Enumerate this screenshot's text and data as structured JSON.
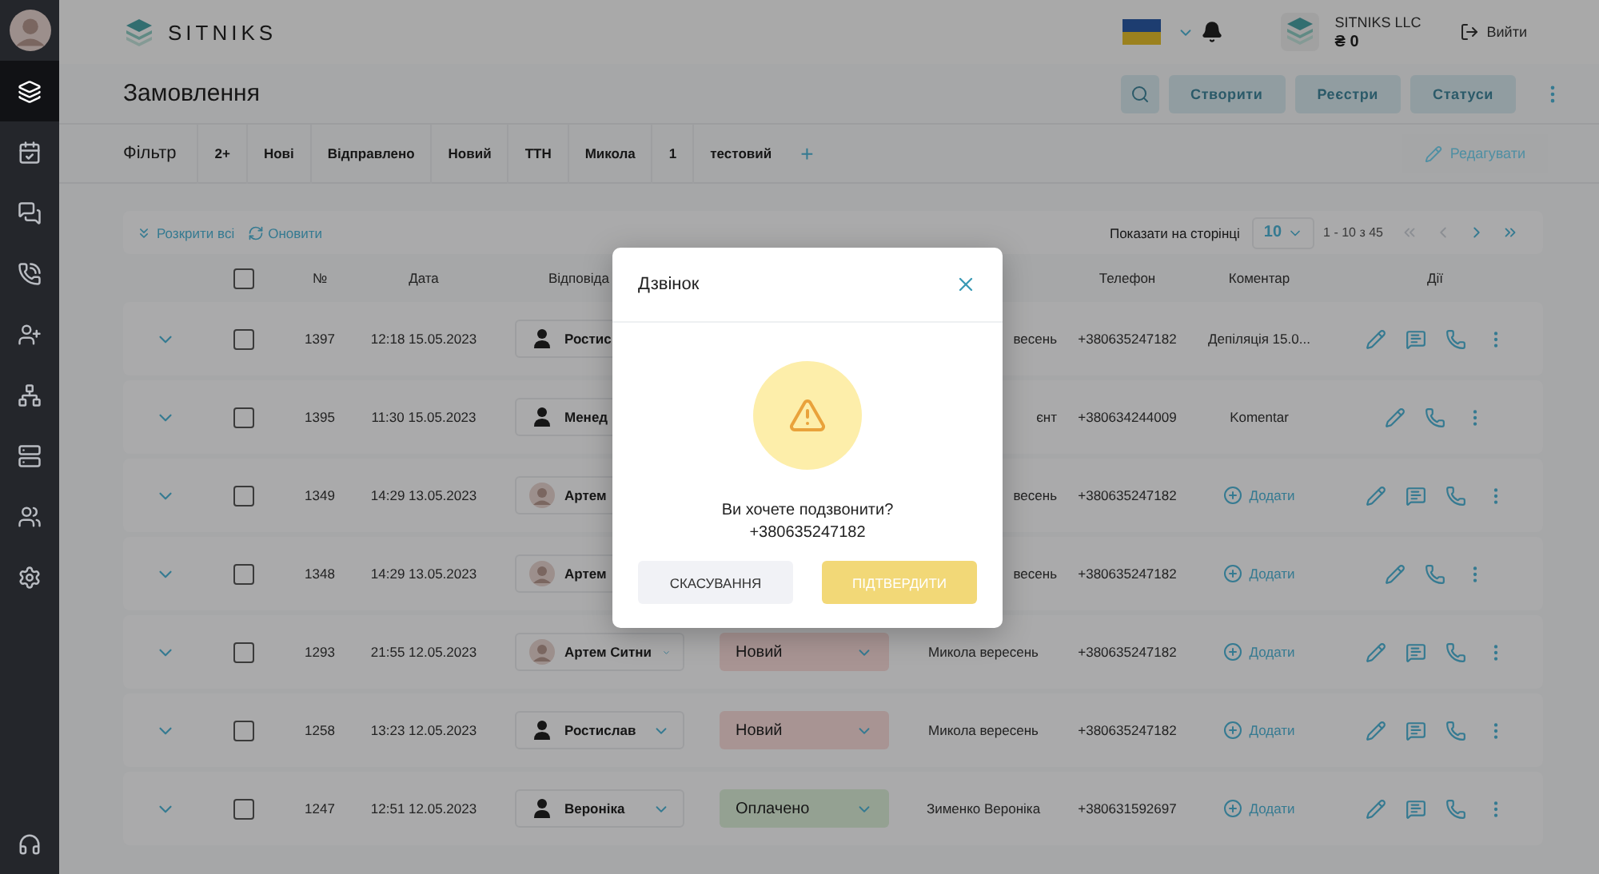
{
  "sidebar": {
    "items": [
      {
        "kind": "orders",
        "selected": true
      },
      {
        "kind": "calendar",
        "selected": false
      },
      {
        "kind": "chats",
        "selected": false
      },
      {
        "kind": "calls",
        "selected": false
      },
      {
        "kind": "add-user",
        "selected": false
      },
      {
        "kind": "structure",
        "selected": false
      },
      {
        "kind": "storage",
        "selected": false
      },
      {
        "kind": "users",
        "selected": false
      },
      {
        "kind": "settings",
        "selected": false
      }
    ],
    "bottom_item": {
      "kind": "support",
      "selected": false
    }
  },
  "header": {
    "logo": "SITNIKS",
    "company": "SITNIKS LLC",
    "balance": "₴ 0",
    "logout": "Вийти"
  },
  "page": {
    "title": "Замовлення",
    "buttons": [
      "Створити",
      "Реєстри",
      "Статуси"
    ]
  },
  "filter": {
    "label": "Фільтр",
    "chips": [
      "2+",
      "Нові",
      "Відправлено",
      "Новий",
      "ТТН",
      "Микола",
      "1",
      "тестовий"
    ],
    "add": "+",
    "edit": "Редагувати"
  },
  "toolbar": {
    "expand_all": "Розкрити всі",
    "refresh": "Оновити",
    "page_size_label": "Показати на сторінці",
    "page_size": "10",
    "range": "1 - 10 з 45"
  },
  "table": {
    "all_checked": false,
    "columns": [
      "№",
      "Дата",
      "Відповіда",
      "Телефон",
      "Коментар",
      "Дії"
    ],
    "rows": [
      {
        "number": "1397",
        "date": "12:18 15.05.2023",
        "responsible": {
          "name": "Ростис",
          "kind": "user"
        },
        "client": "весень",
        "phone": "+380635247182",
        "comment": {
          "kind": "text",
          "text": "Депіляція 15.0..."
        },
        "actions": [
          {
            "kind": "edit"
          },
          {
            "kind": "comment"
          },
          {
            "kind": "call"
          },
          {
            "kind": "more"
          }
        ],
        "checked": false
      },
      {
        "number": "1395",
        "date": "11:30 15.05.2023",
        "responsible": {
          "name": "Менед",
          "kind": "user"
        },
        "client": "єнт",
        "phone": "+380634244009",
        "comment": {
          "kind": "text",
          "text": "Komentar"
        },
        "actions": [
          {
            "kind": "edit"
          },
          {
            "kind": "call"
          },
          {
            "kind": "more"
          }
        ],
        "checked": false
      },
      {
        "number": "1349",
        "date": "14:29 13.05.2023",
        "responsible": {
          "name": "Артем",
          "kind": "photo"
        },
        "client": "весень",
        "phone": "+380635247182",
        "comment": {
          "kind": "add",
          "text": "Додати"
        },
        "actions": [
          {
            "kind": "edit"
          },
          {
            "kind": "comment"
          },
          {
            "kind": "call"
          },
          {
            "kind": "more"
          }
        ],
        "checked": false
      },
      {
        "number": "1348",
        "date": "14:29 13.05.2023",
        "responsible": {
          "name": "Артем",
          "kind": "photo"
        },
        "client": "весень",
        "phone": "+380635247182",
        "comment": {
          "kind": "add",
          "text": "Додати"
        },
        "actions": [
          {
            "kind": "edit"
          },
          {
            "kind": "call"
          },
          {
            "kind": "more"
          }
        ],
        "checked": false
      },
      {
        "number": "1293",
        "date": "21:55 12.05.2023",
        "responsible": {
          "name": "Артем Ситни",
          "kind": "photo"
        },
        "status": {
          "label": "Новий",
          "color": "#a89493"
        },
        "client": "Микола вересень",
        "phone": "+380635247182",
        "comment": {
          "kind": "add",
          "text": "Додати"
        },
        "actions": [
          {
            "kind": "edit"
          },
          {
            "kind": "comment"
          },
          {
            "kind": "call"
          },
          {
            "kind": "more"
          }
        ],
        "checked": false
      },
      {
        "number": "1258",
        "date": "13:23 12.05.2023",
        "responsible": {
          "name": "Ростислав",
          "kind": "user"
        },
        "status": {
          "label": "Новий",
          "color": "#a89493"
        },
        "client": "Микола вересень",
        "phone": "+380635247182",
        "comment": {
          "kind": "add",
          "text": "Додати"
        },
        "actions": [
          {
            "kind": "edit"
          },
          {
            "kind": "comment"
          },
          {
            "kind": "call"
          },
          {
            "kind": "more"
          }
        ],
        "checked": false
      },
      {
        "number": "1247",
        "date": "12:51 12.05.2023",
        "responsible": {
          "name": "Вероніка",
          "kind": "user"
        },
        "status": {
          "label": "Оплачено",
          "color": "#94a192"
        },
        "client": "Зименко Вероніка",
        "phone": "+380631592697",
        "comment": {
          "kind": "add",
          "text": "Додати"
        },
        "actions": [
          {
            "kind": "edit"
          },
          {
            "kind": "comment"
          },
          {
            "kind": "call"
          },
          {
            "kind": "more"
          }
        ],
        "checked": false
      }
    ]
  },
  "dialog": {
    "title": "Дзвінок",
    "question": "Ви хочете подзвонити?",
    "phone": "+380635247182",
    "cancel": "СКАСУВАННЯ",
    "confirm": "ПІДТВЕРДИТИ"
  }
}
